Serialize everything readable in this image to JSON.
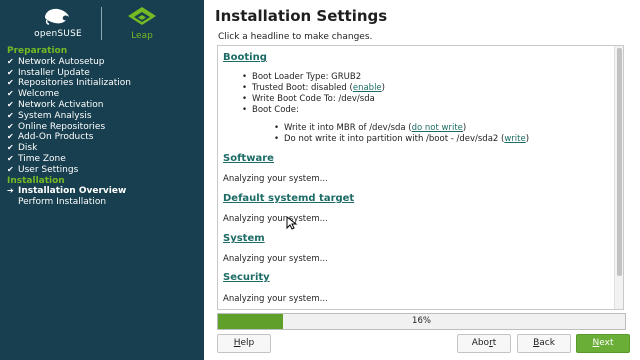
{
  "sidebar": {
    "logo_opensuse": "openSUSE",
    "logo_leap": "Leap",
    "groups": [
      {
        "heading": "Preparation",
        "steps": [
          {
            "label": "Network Autosetup",
            "state": "done"
          },
          {
            "label": "Installer Update",
            "state": "done"
          },
          {
            "label": "Repositories Initialization",
            "state": "done"
          },
          {
            "label": "Welcome",
            "state": "done"
          },
          {
            "label": "Network Activation",
            "state": "done"
          },
          {
            "label": "System Analysis",
            "state": "done"
          },
          {
            "label": "Online Repositories",
            "state": "done"
          },
          {
            "label": "Add-On Products",
            "state": "done"
          },
          {
            "label": "Disk",
            "state": "done"
          },
          {
            "label": "Time Zone",
            "state": "done"
          },
          {
            "label": "User Settings",
            "state": "done"
          }
        ]
      },
      {
        "heading": "Installation",
        "steps": [
          {
            "label": "Installation Overview",
            "state": "current"
          },
          {
            "label": "Perform Installation",
            "state": "pending"
          }
        ]
      }
    ],
    "done_mark": "✔",
    "current_mark": "➔"
  },
  "main": {
    "title": "Installation Settings",
    "hint": "Click a headline to make changes.",
    "booting": {
      "heading": "Booting",
      "loader_type": "Boot Loader Type: GRUB2",
      "trusted_boot_prefix": "Trusted Boot: disabled (",
      "trusted_boot_link": "enable",
      "trusted_boot_suffix": ")",
      "write_code": "Write Boot Code To: /dev/sda",
      "boot_code": "Boot Code:",
      "mbr_prefix": "Write it into MBR of /dev/sda (",
      "mbr_link": "do not write",
      "mbr_suffix": ")",
      "partition_prefix": "Do not write it into partition with /boot - /dev/sda2 (",
      "partition_link": "write",
      "partition_suffix": ")"
    },
    "software": {
      "heading": "Software",
      "status": "Analyzing your system..."
    },
    "systemd_target": {
      "heading": "Default systemd target",
      "status": "Analyzing your system..."
    },
    "system": {
      "heading": "System",
      "status": "Analyzing your system..."
    },
    "security": {
      "heading": "Security",
      "status": "Analyzing your system..."
    }
  },
  "progress": {
    "value": 0.16,
    "label": "16%"
  },
  "buttons": {
    "help": {
      "underlined": "H",
      "rest": "elp"
    },
    "abort": {
      "pre": "Abo",
      "underlined": "r",
      "rest": "t"
    },
    "back": {
      "underlined": "B",
      "rest": "ack"
    },
    "next": {
      "underlined": "N",
      "rest": "ext"
    }
  },
  "colors": {
    "sidebar_bg": "#173f4f",
    "accent_green": "#73ba25",
    "link_teal": "#1c6b66",
    "progress_fill": "#5ea02a",
    "next_button": "#6aad37"
  }
}
